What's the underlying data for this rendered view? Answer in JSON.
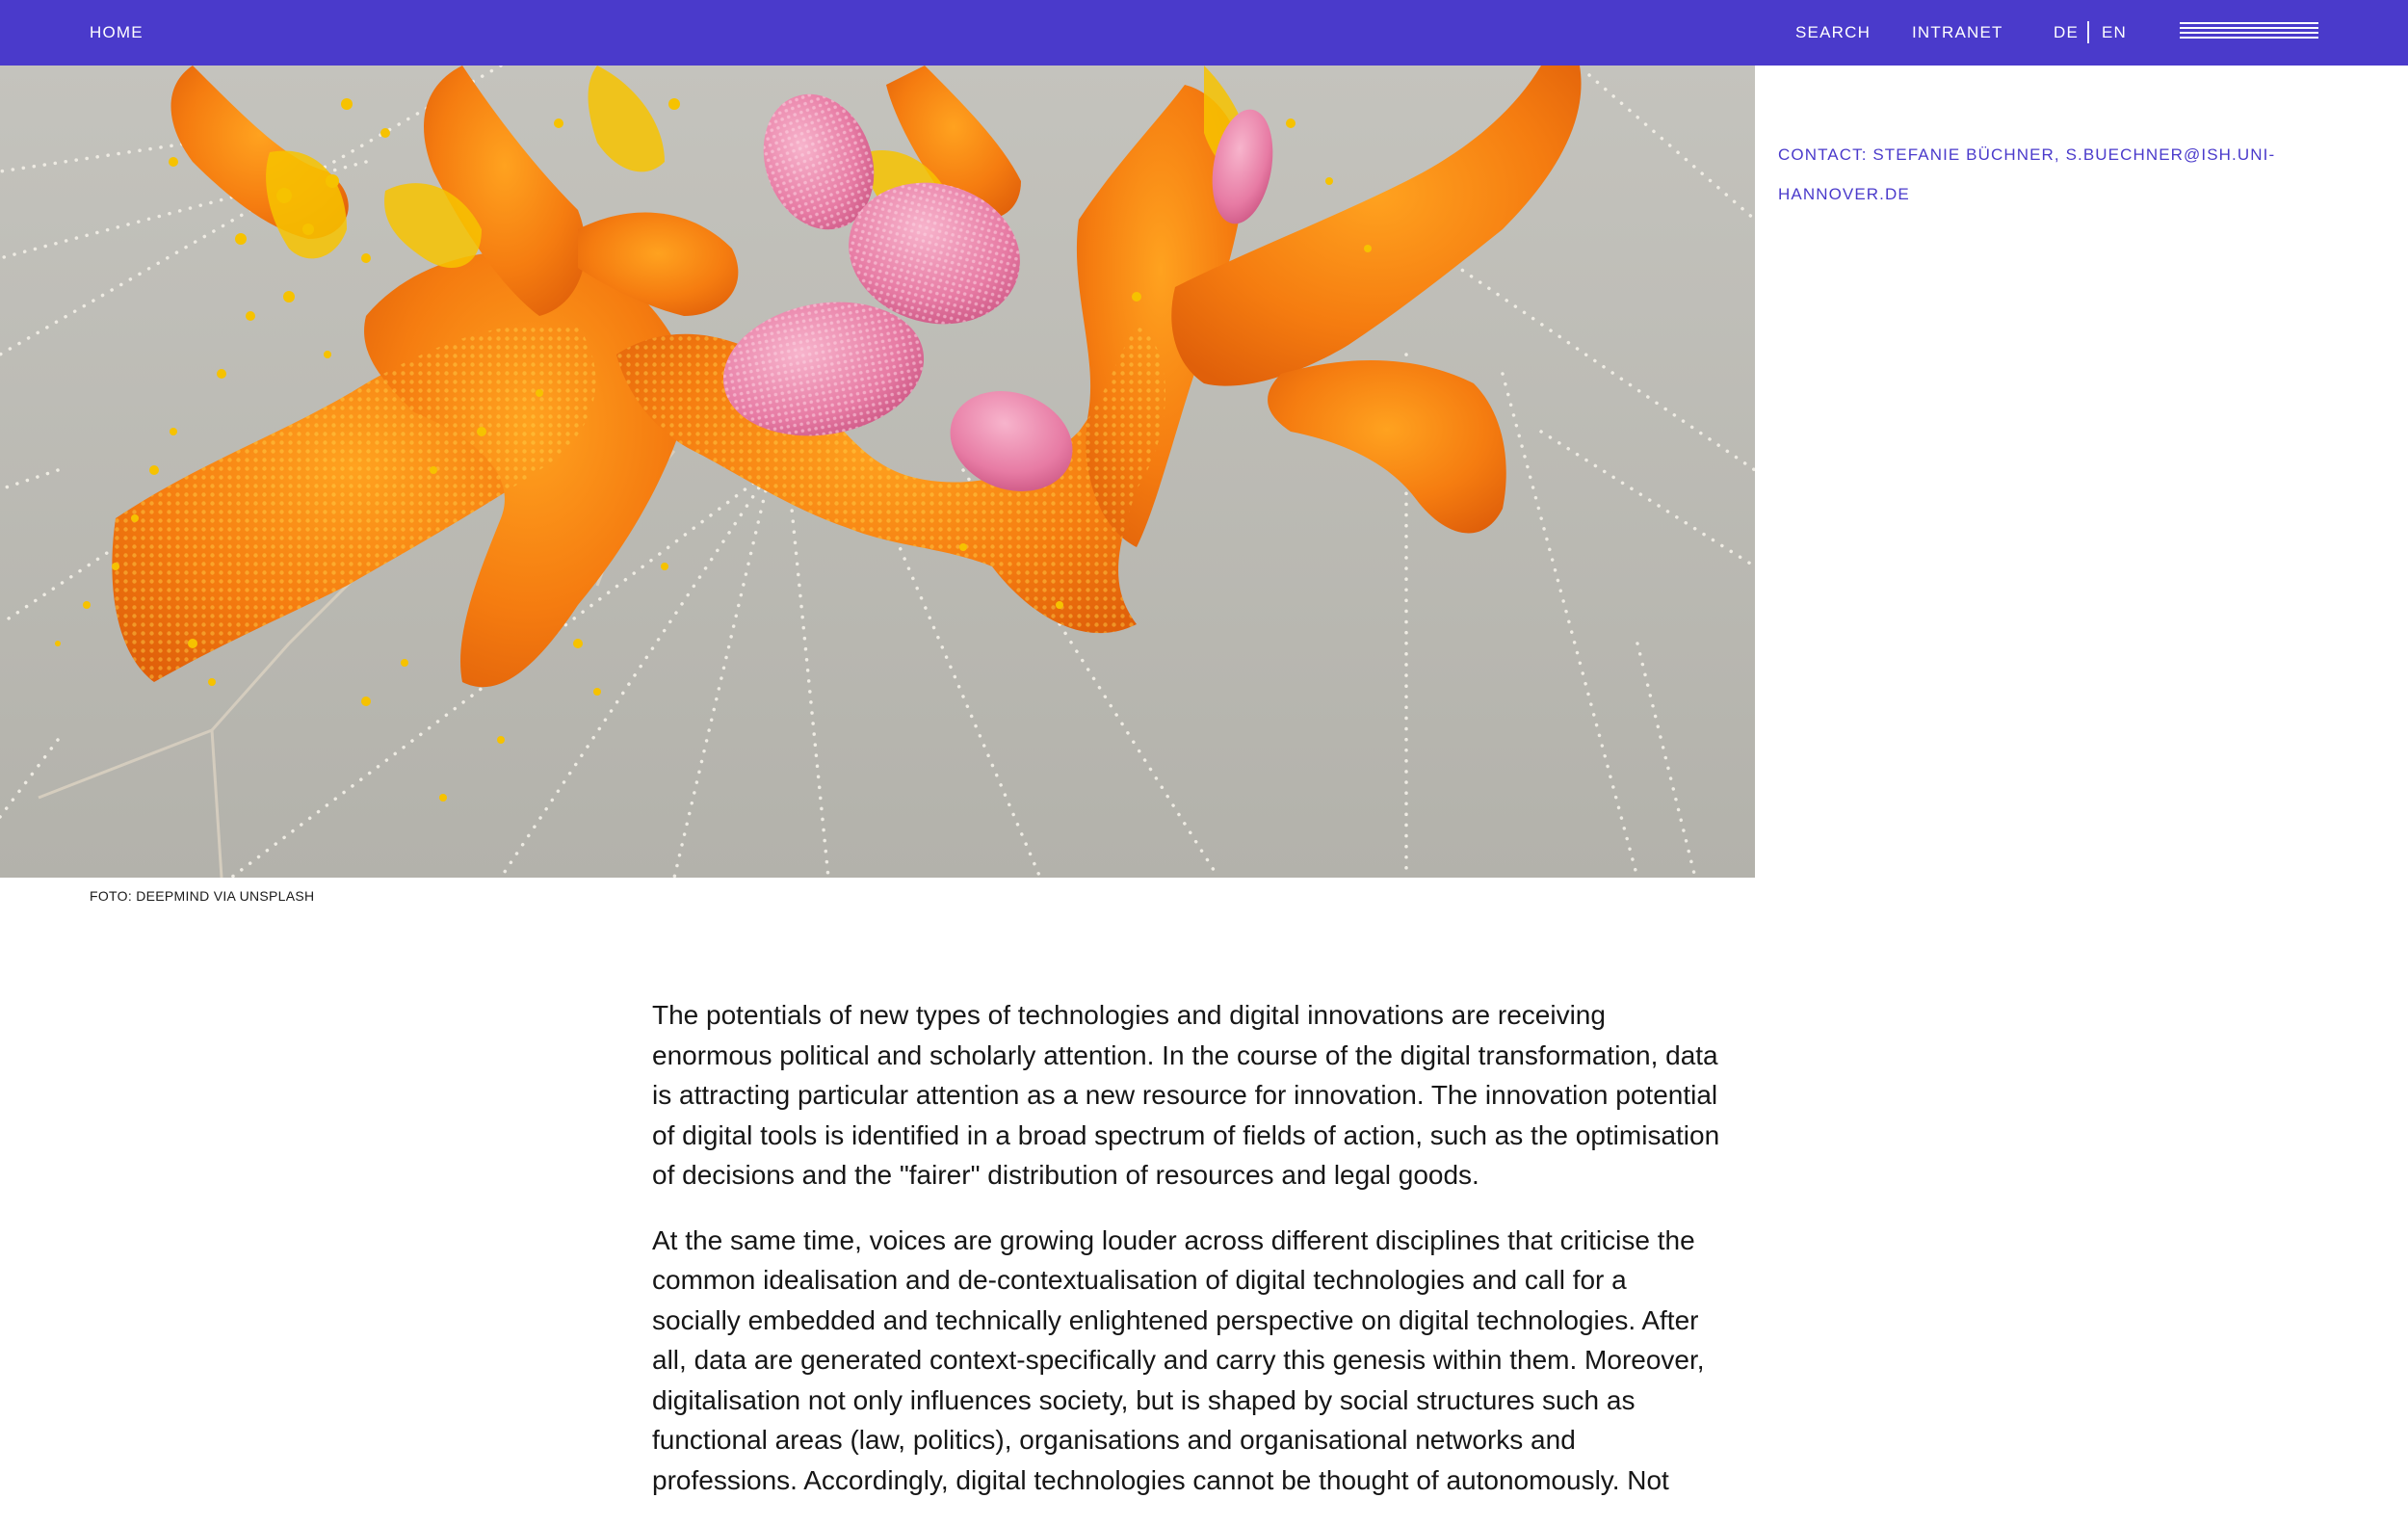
{
  "nav": {
    "home": "HOME",
    "search": "SEARCH",
    "intranet": "INTRANET",
    "lang_de": "DE",
    "lang_en": "EN"
  },
  "hero": {
    "caption": "FOTO: DEEPMIND VIA UNSPLASH"
  },
  "sidebar": {
    "contact": "CONTACT: STEFANIE BÜCHNER, S.BUECHNER@ISH.UNI-HANNOVER.DE"
  },
  "article": {
    "paragraphs": [
      "The potentials of new types of technologies and digital innovations are receiving enormous political and scholarly attention. In the course of the digital transformation, data is attracting particular attention as a new resource for innovation. The innovation potential of digital tools is identified in a broad spectrum of fields of action, such as the optimisation of decisions and the \"fairer\" distribution of resources and legal goods.",
      "At the same time, voices are growing louder across different disciplines that criticise the common idealisation and de-contextualisation of digital technologies and call for a socially embedded and technically enlightened perspective on digital technologies. After all, data are generated context-specifically and carry this genesis within them. Moreover, digitalisation not only influences society, but is shaped by social structures such as functional areas (law, politics), organisations and organisational networks and professions. Accordingly, digital technologies cannot be thought of autonomously. Not"
    ]
  },
  "colors": {
    "brand": "#4a3acb",
    "hero_background": "#b9b8b2",
    "orange": "#f07a12",
    "yellow": "#f6c400",
    "pink": "#e87aa5"
  },
  "icons": {
    "menu": "hamburger-menu-icon"
  }
}
